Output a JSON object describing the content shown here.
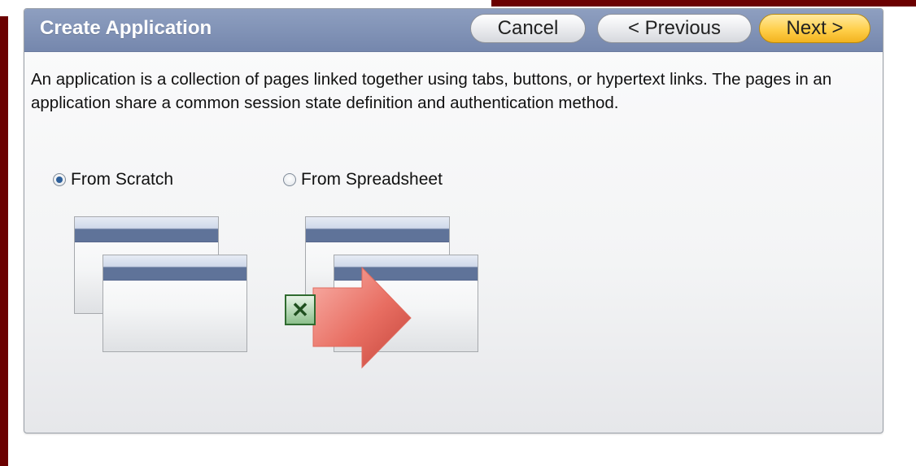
{
  "dialog": {
    "title": "Create Application",
    "buttons": {
      "cancel": "Cancel",
      "previous": "< Previous",
      "next": "Next >"
    },
    "description": "An application is a collection of pages linked together using tabs, buttons, or hypertext links. The pages in an application share a common session state definition and authentication method.",
    "options": [
      {
        "label": "From Scratch",
        "selected": true
      },
      {
        "label": "From Spreadsheet",
        "selected": false
      }
    ]
  },
  "icons": {
    "radio": "radio-button",
    "page": "window-page-icon",
    "spreadsheet": "excel-icon",
    "arrow": "import-arrow-icon"
  },
  "colors": {
    "header": "#7f91b6",
    "next_button": "#ffcf4a",
    "frame": "#6b0000"
  }
}
